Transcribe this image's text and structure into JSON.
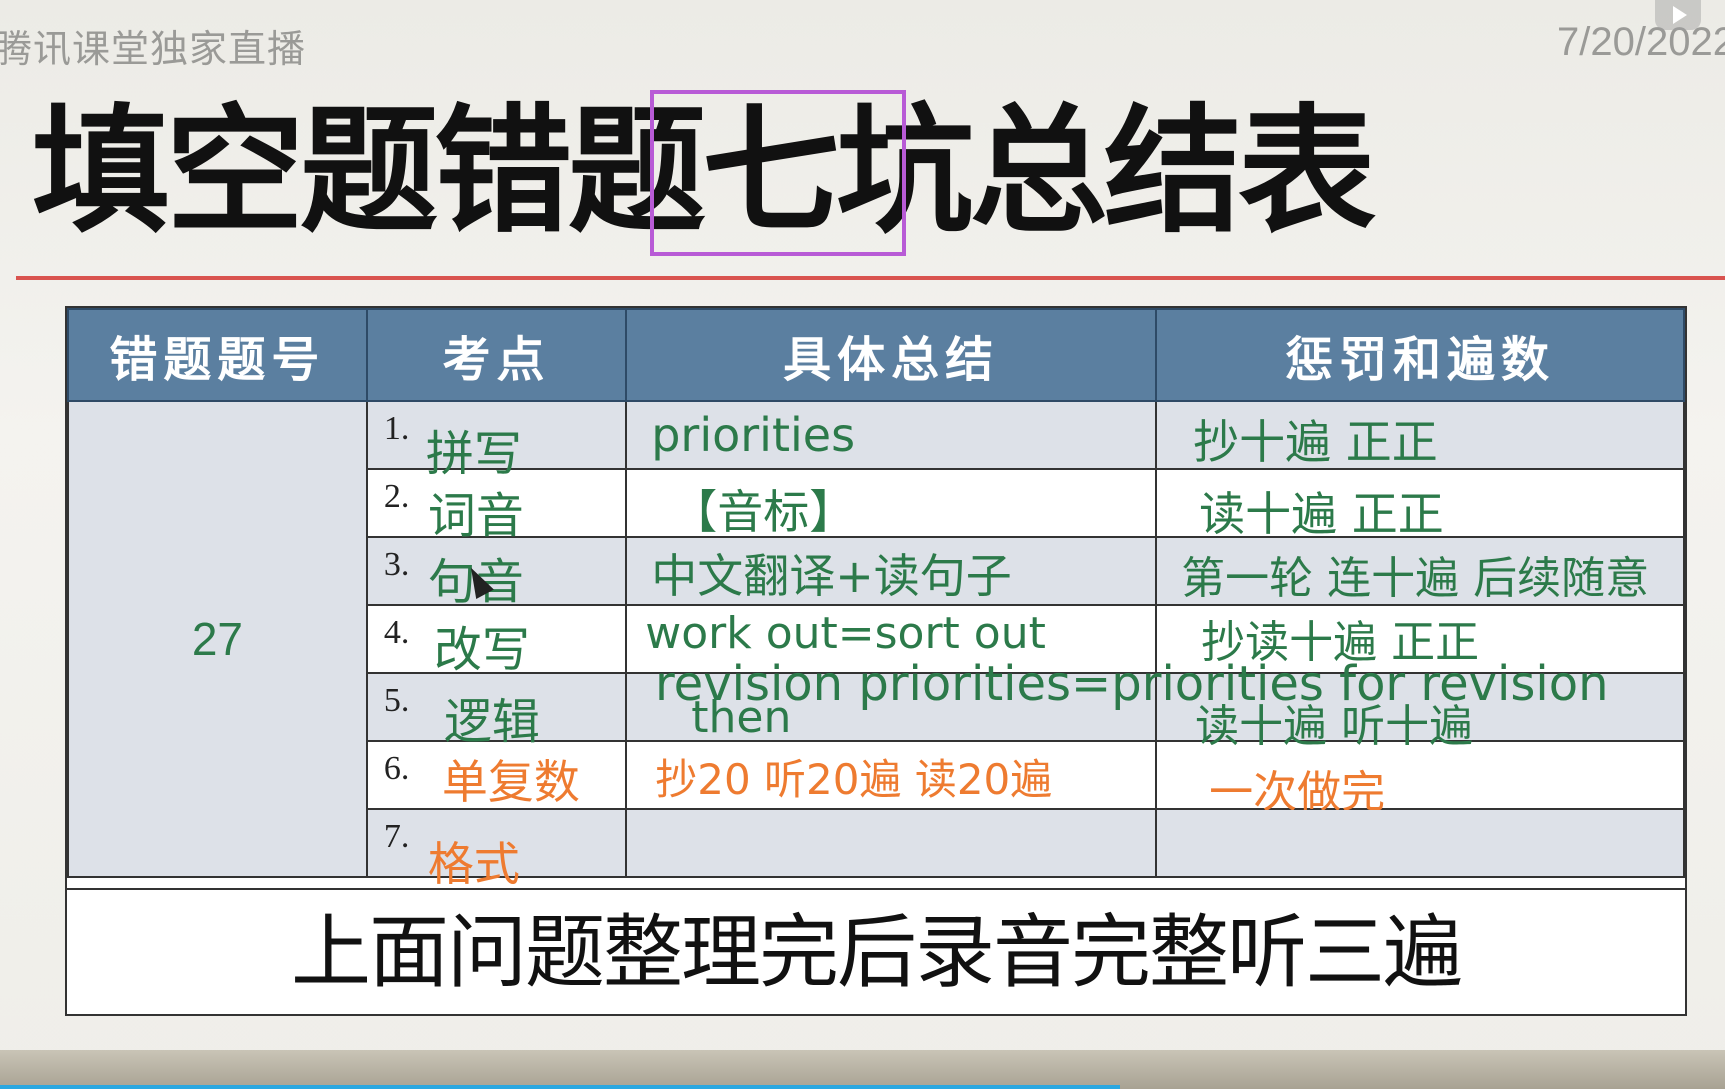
{
  "header": {
    "watermark": "腾讯课堂独家直播",
    "date": "7/20/2022",
    "title": "填空题错题七坑总结表"
  },
  "table": {
    "columns": [
      "错题题号",
      "考点",
      "具体总结",
      "惩罚和遍数"
    ],
    "question_number": "27",
    "rows": [
      {
        "idx": "1.",
        "point": "拼写",
        "summary": "priorities",
        "penalty": "抄十遍 正正"
      },
      {
        "idx": "2.",
        "point": "词音",
        "summary": "【音标】",
        "penalty": "读十遍    正正"
      },
      {
        "idx": "3.",
        "point": "句音",
        "summary": "中文翻译+读句子",
        "penalty": "第一轮 连十遍 后续随意"
      },
      {
        "idx": "4.",
        "point": "改写",
        "summary": "work out=sort out",
        "penalty": "抄读十遍 正正"
      },
      {
        "idx": "5.",
        "point": "逻辑",
        "summary": "then",
        "penalty": "读十遍 听十遍"
      },
      {
        "idx": "6.",
        "point": "单复数",
        "summary": "抄20 听20遍   读20遍",
        "penalty": "一次做完"
      },
      {
        "idx": "7.",
        "point": "格式",
        "summary": "",
        "penalty": ""
      }
    ],
    "overlay_note": "revision priorities=priorities for revision",
    "footer": "上面问题整理完后录音完整听三遍"
  },
  "colors": {
    "header_bg": "#5b7fa0",
    "green_ink": "#2c7a4a",
    "orange_ink": "#ee7b30",
    "rule": "#d9534f",
    "highlight_box": "#b85bd6"
  }
}
